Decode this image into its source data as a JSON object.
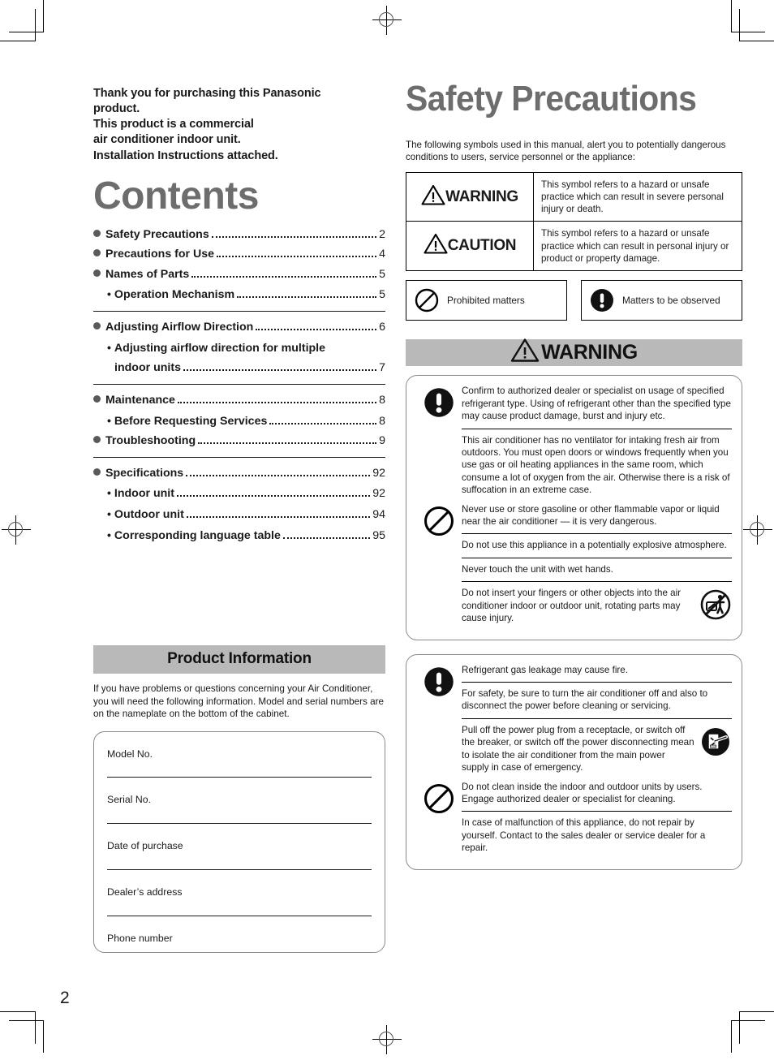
{
  "page": {
    "number": "2"
  },
  "left": {
    "thanks_lines": [
      "Thank you for purchasing this Panasonic",
      "product.",
      "This product is a commercial",
      "air conditioner indoor unit.",
      "Installation Instructions attached."
    ],
    "contents_title": "Contents",
    "toc_groups": [
      {
        "rows": [
          {
            "marker": "bullet",
            "label": "Safety Precautions",
            "page": "2",
            "leader": true
          },
          {
            "marker": "bullet",
            "label": "Precautions for Use",
            "page": "4",
            "leader": true
          },
          {
            "marker": "bullet",
            "label": "Names of Parts",
            "page": "5",
            "leader": true
          },
          {
            "marker": "dot",
            "label": "Operation Mechanism",
            "page": "5",
            "leader": true
          }
        ]
      },
      {
        "rows": [
          {
            "marker": "bullet",
            "label": "Adjusting Airflow Direction",
            "page": "6",
            "leader": true
          },
          {
            "marker": "dot",
            "label": "Adjusting airflow direction for multiple",
            "page": "",
            "leader": false
          },
          {
            "marker": "cont",
            "label": "indoor units",
            "page": "7",
            "leader": true
          }
        ]
      },
      {
        "rows": [
          {
            "marker": "bullet",
            "label": "Maintenance",
            "page": "8",
            "leader": true
          },
          {
            "marker": "dot",
            "label": "Before Requesting Services",
            "page": "8",
            "leader": true
          },
          {
            "marker": "bullet",
            "label": "Troubleshooting",
            "page": "9",
            "leader": true
          }
        ]
      },
      {
        "rows": [
          {
            "marker": "bullet",
            "label": "Specifications",
            "page": "92",
            "leader": true
          },
          {
            "marker": "dot",
            "label": "Indoor unit",
            "page": "92",
            "leader": true
          },
          {
            "marker": "dot",
            "label": "Outdoor unit",
            "page": "94",
            "leader": true
          },
          {
            "marker": "dot",
            "label": "Corresponding language table",
            "page": "95",
            "leader": true
          }
        ]
      }
    ],
    "product_info": {
      "banner": "Product Information",
      "body": "If you have problems or questions concerning your Air Conditioner, you will need the following information. Model and serial numbers are on the nameplate on the bottom of the cabinet.",
      "fields": [
        "Model No.",
        "Serial No.",
        "Date of purchase",
        "Dealer’s address",
        "Phone number"
      ]
    }
  },
  "right": {
    "title": "Safety Precautions",
    "intro": "The following symbols used in this manual, alert you to potentially dangerous conditions to users, service personnel or the appliance:",
    "symbol_table": [
      {
        "icon": "warning-triangle-icon",
        "label": "WARNING",
        "description": "This symbol refers to a hazard or unsafe practice which can result in severe personal injury or death."
      },
      {
        "icon": "warning-triangle-icon",
        "label": "CAUTION",
        "description": "This symbol refers to a hazard or unsafe practice which can result in personal injury or product or property damage."
      }
    ],
    "legend": [
      {
        "icon": "prohibited-icon",
        "label": "Prohibited matters"
      },
      {
        "icon": "mandatory-icon",
        "label": "Matters to be observed"
      }
    ],
    "warning_banner": "WARNING",
    "warning_boxes": [
      {
        "groups": [
          {
            "icon": "mandatory-icon",
            "items": [
              {
                "text": "Confirm to authorized dealer or specialist on usage of specified refrigerant type. Using of refrigerant other than the specified type may cause product damage, burst and injury etc.",
                "aside_icon": ""
              },
              {
                "text": "This air conditioner has no ventilator for intaking fresh air from outdoors. You must open doors or windows frequently when you use gas or oil heating appliances in the same room, which consume a lot of oxygen from the air. Otherwise there is a risk of suffocation in an extreme case.",
                "aside_icon": ""
              }
            ]
          },
          {
            "icon": "prohibited-icon",
            "items": [
              {
                "text": "Never use or store gasoline or other flammable vapor or liquid near the air conditioner — it is very dangerous.",
                "aside_icon": ""
              },
              {
                "text": "Do not use this appliance in a potentially explosive atmosphere.",
                "aside_icon": ""
              },
              {
                "text": "Never touch the unit with wet hands.",
                "aside_icon": ""
              },
              {
                "text": "Do not insert your fingers or other objects into the air conditioner indoor or outdoor unit, rotating parts may cause injury.",
                "aside_icon": "no-fingers-icon"
              }
            ]
          }
        ]
      },
      {
        "groups": [
          {
            "icon": "mandatory-icon",
            "items": [
              {
                "text": "Refrigerant gas leakage may cause fire.",
                "aside_icon": ""
              },
              {
                "text": "For safety, be sure to turn the air conditioner off and also to disconnect the power before cleaning or servicing.",
                "aside_icon": ""
              },
              {
                "text": "Pull off the power plug from a receptacle, or switch off the breaker, or switch off the power disconnecting mean to isolate the air conditioner from the main power supply in case of emergency.",
                "aside_icon": "unplug-icon"
              }
            ]
          },
          {
            "icon": "prohibited-icon",
            "items": [
              {
                "text": "Do not clean inside the indoor and outdoor units by users. Engage authorized dealer or specialist for cleaning.",
                "aside_icon": ""
              },
              {
                "text": "In case of malfunction of this appliance, do not repair by yourself. Contact to the sales dealer or service dealer for a repair.",
                "aside_icon": ""
              }
            ]
          }
        ]
      }
    ]
  },
  "colors": {
    "heading_gray": "#6d6d6d",
    "banner_gray": "#b9b9b9",
    "rule_black": "#1a1a1a",
    "box_border": "#8a8a8a"
  }
}
